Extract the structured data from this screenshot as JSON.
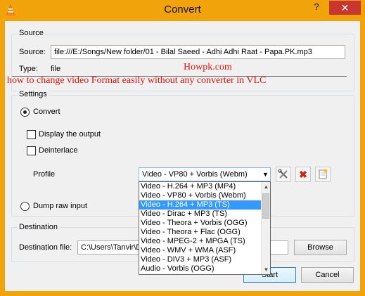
{
  "window": {
    "title": "Convert",
    "help": "?",
    "close": "✕"
  },
  "source": {
    "group_label": "Source",
    "source_label": "Source:",
    "source_value": "file:///E:/Songs/New folder/01 - Bilal Saeed - Adhi Adhi Raat - Papa.PK.mp3",
    "type_label": "Type:",
    "type_value": "file"
  },
  "overlay": {
    "site": "Howpk.com",
    "caption": "how to change video Format easily without any converter in VLC"
  },
  "settings": {
    "group_label": "Settings",
    "convert_label": "Convert",
    "convert_selected": true,
    "display_output_label": "Display the output",
    "display_output_checked": false,
    "deinterlace_label": "Deinterlace",
    "deinterlace_checked": false,
    "profile_label": "Profile",
    "profile_selected": "Video - VP80 + Vorbis (Webm)",
    "dump_raw_label": "Dump raw input",
    "dump_raw_selected": false
  },
  "profile_options": [
    "Video - H.264 + MP3 (MP4)",
    "Video - VP80 + Vorbis (Webm)",
    "Video - H.264 + MP3 (TS)",
    "Video - Dirac + MP3 (TS)",
    "Video - Theora + Vorbis (OGG)",
    "Video - Theora + Flac (OGG)",
    "Video - MPEG-2 + MPGA (TS)",
    "Video - WMV + WMA (ASF)",
    "Video - DIV3 + MP3 (ASF)",
    "Audio - Vorbis (OGG)"
  ],
  "highlighted_option": "Video - H.264 + MP3 (TS)",
  "destination": {
    "group_label": "Destination",
    "file_label": "Destination file:",
    "file_value": "C:\\Users\\Tanvir\\D",
    "browse_label": "Browse"
  },
  "buttons": {
    "start": "Start",
    "cancel": "Cancel"
  },
  "icons": {
    "app": "vlc-cone-icon",
    "edit_profile": "wrench-screwdriver-icon",
    "delete_profile": "red-x-icon",
    "new_profile": "new-document-icon"
  },
  "colors": {
    "titlebar": "#f0a30a",
    "close": "#c7372f",
    "overlay_text": "#e8120c",
    "selection": "#3399ff"
  }
}
